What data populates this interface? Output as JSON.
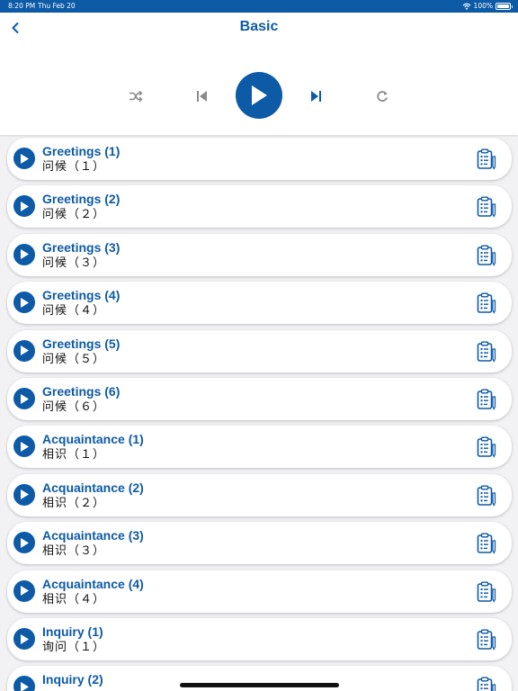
{
  "status_bar": {
    "time": "8:20 PM",
    "date": "Thu Feb 20",
    "battery": "100%",
    "battery_level": 1.0
  },
  "header": {
    "title": "Basic"
  },
  "colors": {
    "accent": "#0d5aa7",
    "control_gray": "#8a8a8a",
    "background": "#f2f2f4"
  },
  "icons": {
    "back": "chevron-left-icon",
    "shuffle": "shuffle-icon",
    "previous": "skip-previous-icon",
    "play": "play-icon",
    "next": "skip-next-icon",
    "repeat": "repeat-icon",
    "item_action": "clipboard-list-icon"
  },
  "lessons": [
    {
      "title": "Greetings (1)",
      "subtitle": "问候（１）"
    },
    {
      "title": "Greetings (2)",
      "subtitle": "问候（２）"
    },
    {
      "title": "Greetings (3)",
      "subtitle": "问候（３）"
    },
    {
      "title": "Greetings (4)",
      "subtitle": "问候（４）"
    },
    {
      "title": "Greetings (5)",
      "subtitle": "问候（５）"
    },
    {
      "title": "Greetings (6)",
      "subtitle": "问候（６）"
    },
    {
      "title": "Acquaintance (1)",
      "subtitle": "相识（１）"
    },
    {
      "title": "Acquaintance (2)",
      "subtitle": "相识（２）"
    },
    {
      "title": "Acquaintance (3)",
      "subtitle": "相识（３）"
    },
    {
      "title": "Acquaintance (4)",
      "subtitle": "相识（４）"
    },
    {
      "title": "Inquiry (1)",
      "subtitle": "询问（１）"
    },
    {
      "title": "Inquiry (2)",
      "subtitle": ""
    }
  ]
}
